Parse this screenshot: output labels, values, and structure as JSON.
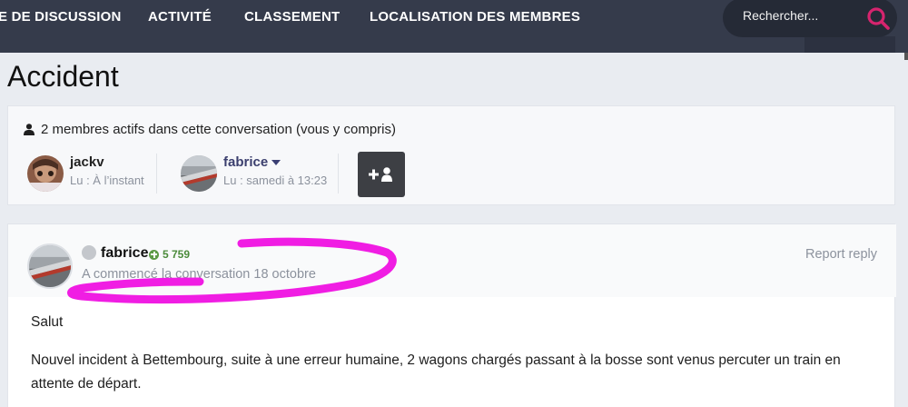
{
  "nav": {
    "items": [
      {
        "label": "E DE DISCUSSION"
      },
      {
        "label": "ACTIVITÉ"
      },
      {
        "label": "CLASSEMENT"
      },
      {
        "label": "LOCALISATION DES MEMBRES"
      }
    ],
    "search_placeholder": "Rechercher...",
    "search_icon": "search-icon",
    "accent_color": "#d6246e"
  },
  "page": {
    "title": "Accident"
  },
  "participants": {
    "header": "2 membres actifs dans cette conversation (vous y compris)",
    "members": [
      {
        "name": "jackv",
        "meta": "Lu : À l’instant"
      },
      {
        "name": "fabrice",
        "meta": "Lu : samedi à 13:23"
      }
    ],
    "add_button_icon": "add-user-icon"
  },
  "post": {
    "author": "fabrice",
    "reputation": "5 759",
    "started": "A commencé la conversation 18 octobre",
    "report_label": "Report reply",
    "body": [
      "Salut",
      "Nouvel incident à Bettembourg, suite à une erreur humaine, 2 wagons chargés passant à la bosse sont venus percuter un train en",
      "attente de départ."
    ],
    "annotation_color": "#f01de3"
  }
}
